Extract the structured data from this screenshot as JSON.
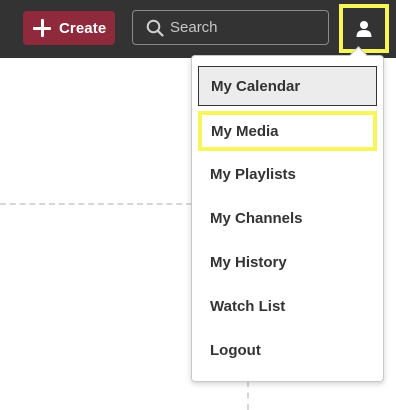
{
  "header": {
    "create_label": "Create",
    "search_placeholder": "Search",
    "user_icon": "user-icon"
  },
  "user_menu": {
    "items": [
      {
        "label": "My Calendar",
        "state": "selected"
      },
      {
        "label": "My Media",
        "state": "highlighted"
      },
      {
        "label": "My Playlists"
      },
      {
        "label": "My Channels"
      },
      {
        "label": "My History"
      },
      {
        "label": "Watch List"
      },
      {
        "label": "Logout"
      }
    ]
  },
  "colors": {
    "topbar": "#333333",
    "create_button": "#8e2a3b",
    "highlight": "#f6f65a"
  }
}
